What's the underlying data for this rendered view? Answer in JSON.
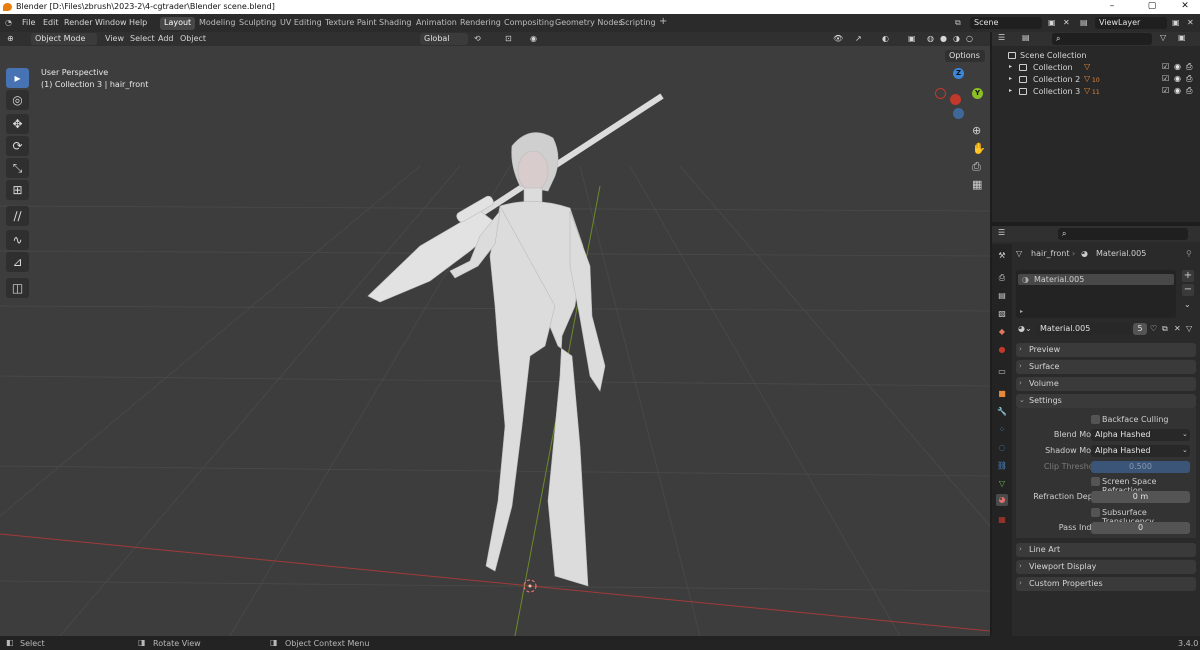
{
  "window": {
    "title": "Blender [D:\\Files\\zbrush\\2023-2\\4-cgtrader\\Blender scene.blend]"
  },
  "menu": [
    "File",
    "Edit",
    "Render",
    "Window",
    "Help"
  ],
  "workspaces": [
    "Layout",
    "Modeling",
    "Sculpting",
    "UV Editing",
    "Texture Paint",
    "Shading",
    "Animation",
    "Rendering",
    "Compositing",
    "Geometry Nodes",
    "Scripting"
  ],
  "active_workspace": "Layout",
  "scene": {
    "label": "Scene"
  },
  "view_layer": {
    "label": "ViewLayer"
  },
  "viewport_header": {
    "mode": "Object Mode",
    "menus": [
      "View",
      "Select",
      "Add",
      "Object"
    ],
    "orientation": "Global",
    "options": "Options"
  },
  "viewport": {
    "perspective": "User Perspective",
    "context": "(1) Collection 3 | hair_front"
  },
  "outliner": {
    "root": "Scene Collection",
    "collections": [
      "Collection",
      "Collection 2",
      "Collection 3"
    ],
    "badges": [
      "",
      "10",
      "11"
    ]
  },
  "properties": {
    "object": "hair_front",
    "material": "Material.005",
    "slot": "Material.005",
    "users": "5",
    "panels_top": [
      "Preview",
      "Surface",
      "Volume",
      "Settings"
    ],
    "settings": {
      "backface_culling": "Backface Culling",
      "blend_mode_label": "Blend Mode",
      "blend_mode": "Alpha Hashed",
      "shadow_mode_label": "Shadow Mode",
      "shadow_mode": "Alpha Hashed",
      "clip_threshold_label": "Clip Threshold",
      "clip_threshold": "0.500",
      "ssr": "Screen Space Refraction",
      "refraction_depth_label": "Refraction Depth",
      "refraction_depth": "0 m",
      "sss": "Subsurface Translucency",
      "pass_index_label": "Pass Index",
      "pass_index": "0"
    },
    "panels_bottom": [
      "Line Art",
      "Viewport Display",
      "Custom Properties"
    ]
  },
  "status": {
    "select": "Select",
    "rotate": "Rotate View",
    "context_menu": "Object Context Menu",
    "version": "3.4.0"
  },
  "colors": {
    "accent": "#4772b3",
    "x_axis": "#c0392b",
    "y_axis": "#8cbf26",
    "z_axis": "#3d85d6"
  }
}
